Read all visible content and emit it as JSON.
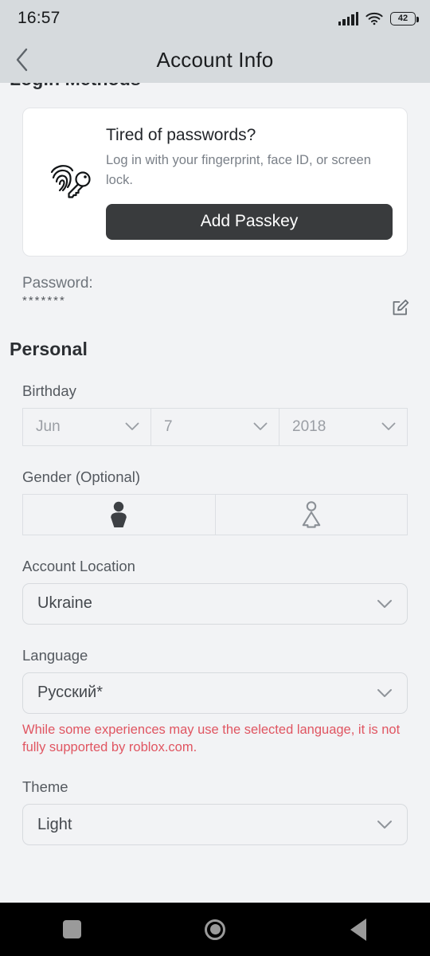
{
  "status_bar": {
    "time": "16:57",
    "signal_icon": "signal-bars-icon",
    "wifi_icon": "wifi-icon",
    "battery_icon": "battery-icon",
    "battery_level": "42"
  },
  "header": {
    "back_icon": "chevron-left-icon",
    "title": "Account Info"
  },
  "login_methods": {
    "section_title": "Login Methods",
    "passkey_card": {
      "icon": "fingerprint-key-icon",
      "title": "Tired of passwords?",
      "description": "Log in with your fingerprint, face ID, or screen lock.",
      "button_label": "Add Passkey"
    },
    "password": {
      "label": "Password:",
      "value": "*******",
      "edit_icon": "edit-pencil-icon"
    }
  },
  "personal": {
    "section_title": "Personal",
    "birthday": {
      "label": "Birthday",
      "month": "Jun",
      "day": "7",
      "year": "2018",
      "chevron_icon": "chevron-down-icon"
    },
    "gender": {
      "label": "Gender (Optional)",
      "male_icon": "male-figure-icon",
      "female_icon": "female-figure-icon",
      "selected": "male"
    },
    "account_location": {
      "label": "Account Location",
      "value": "Ukraine",
      "chevron_icon": "chevron-down-icon"
    },
    "language": {
      "label": "Language",
      "value": "Русский*",
      "chevron_icon": "chevron-down-icon",
      "warning": "While some experiences may use the selected language, it is not fully supported by roblox.com."
    },
    "theme": {
      "label": "Theme",
      "value": "Light",
      "chevron_icon": "chevron-down-icon"
    }
  },
  "nav_bar": {
    "recents_icon": "square-recents-icon",
    "home_icon": "circle-home-icon",
    "back_icon": "triangle-back-icon"
  },
  "colors": {
    "page_background": "#f2f3f5",
    "header_background": "#d6dadd",
    "accent_dark": "#393b3d",
    "warning_red": "#e05561",
    "card_background": "#ffffff"
  }
}
